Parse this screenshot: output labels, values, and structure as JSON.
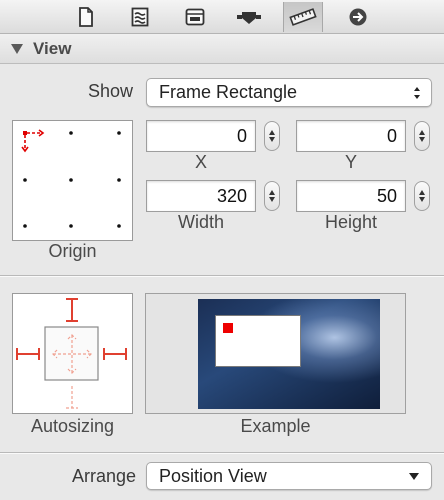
{
  "toolbar": {
    "buttons": [
      {
        "icon": "file-inspector-icon",
        "selected": false
      },
      {
        "icon": "quick-help-icon",
        "selected": false
      },
      {
        "icon": "identity-inspector-icon",
        "selected": false
      },
      {
        "icon": "attributes-inspector-icon",
        "selected": false
      },
      {
        "icon": "size-inspector-icon",
        "selected": true
      },
      {
        "icon": "connections-inspector-icon",
        "selected": false
      }
    ]
  },
  "section": {
    "title": "View",
    "expanded": true
  },
  "show": {
    "label": "Show",
    "value": "Frame Rectangle"
  },
  "origin": {
    "label": "Origin",
    "selected_point": "top-left"
  },
  "fields": {
    "x": {
      "label": "X",
      "value": "0"
    },
    "y": {
      "label": "Y",
      "value": "0"
    },
    "width": {
      "label": "Width",
      "value": "320"
    },
    "height": {
      "label": "Height",
      "value": "50"
    }
  },
  "autosizing": {
    "label": "Autosizing"
  },
  "example": {
    "label": "Example"
  },
  "arrange": {
    "label": "Arrange",
    "value": "Position View"
  },
  "colors": {
    "accent_red": "#e00000",
    "strut_red": "#e05040"
  }
}
